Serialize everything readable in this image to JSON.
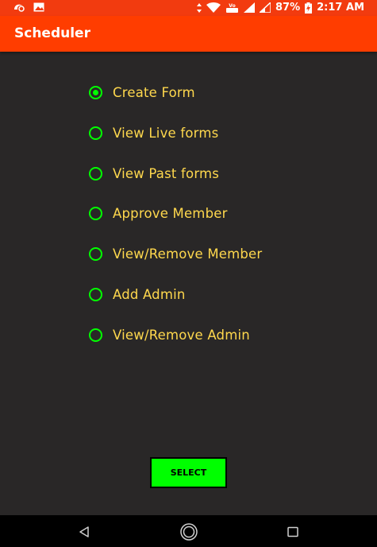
{
  "status_bar": {
    "battery_percent": "87%",
    "time": "2:17 AM",
    "icons": [
      "uc-browser-icon",
      "image-icon",
      "data-arrows-icon",
      "wifi-icon",
      "volte-lte-icon",
      "signal-1-icon",
      "signal-2-icon",
      "battery-charging-icon"
    ]
  },
  "app_bar": {
    "title": "Scheduler",
    "color": "#ff3d00"
  },
  "options": [
    {
      "label": "Create Form",
      "checked": true
    },
    {
      "label": "View Live forms",
      "checked": false
    },
    {
      "label": "View Past forms",
      "checked": false
    },
    {
      "label": "Approve Member",
      "checked": false
    },
    {
      "label": "View/Remove Member",
      "checked": false
    },
    {
      "label": "Add Admin",
      "checked": false
    },
    {
      "label": "View/Remove Admin",
      "checked": false
    }
  ],
  "select_button": {
    "label": "SELECT",
    "color": "#00ff00"
  },
  "nav_bar": {
    "icons": [
      "back-icon",
      "home-icon",
      "recents-icon"
    ]
  },
  "colors": {
    "background": "#292727",
    "radio_accent": "#00ff00",
    "label_text": "#ffd84d"
  }
}
